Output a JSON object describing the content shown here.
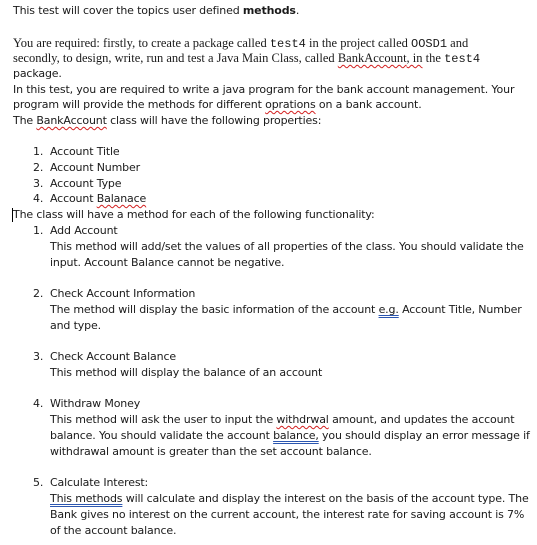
{
  "intro": {
    "text": "This test will cover the topics user defined ",
    "bold": "methods",
    "end": "."
  },
  "requirement": {
    "p1_a": "You are required: firstly, to create a package called ",
    "package_name": "test4",
    "p1_b": " in the project called ",
    "project_name": "OOSD1",
    "p1_c": " and",
    "p2_a": "secondly, to design, write, run and test a Java Main Class, called ",
    "class_name": "BankAccount",
    "p2_b": ", in",
    "p2_c": " the ",
    "package_name_2": "test4",
    "p3": "package."
  },
  "description": {
    "l1": "In this test, you are required to write a java program for the bank account management. Your",
    "l2_a": "program will provide the methods for different ",
    "l2_misspelled": "oprations",
    "l2_b": " on a bank account.",
    "l3_a": "The ",
    "l3_class": "BankAccount",
    "l3_b": " class will have the following properties:"
  },
  "properties": [
    {
      "num": "1.",
      "label": "Account Title"
    },
    {
      "num": "2.",
      "label": "Account Number"
    },
    {
      "num": "3.",
      "label": "Account Type"
    },
    {
      "num": "4.",
      "label_a": "Account ",
      "label_misspelled": "Balanace"
    }
  ],
  "functionality_intro": "The class will have a method for each of the following functionality:",
  "methods": [
    {
      "num": "1.",
      "title": "Add Account",
      "lines": [
        "This method will add/set the values of all properties of the class. You should validate the",
        "input. Account Balance cannot be negative."
      ]
    },
    {
      "num": "2.",
      "title": "Check Account Information",
      "l1_a": "The method will display the basic information of the account ",
      "l1_eg": "e.g.",
      "l1_b": " Account Title, Number",
      "l2": "and type."
    },
    {
      "num": "3.",
      "title": "Check Account Balance",
      "lines": [
        "This method will display the balance of an account"
      ]
    },
    {
      "num": "4.",
      "title": "Withdraw Money",
      "l1_a": "This method will ask the user to input the ",
      "l1_misspelled": "withdrwal",
      "l1_b": " amount, and updates the account",
      "l2_a": "balance. You should validate the account ",
      "l2_gram": "balance,",
      "l2_b": " you should display an error message if",
      "l3": "withdrawal amount is greater than the set account balance."
    },
    {
      "num": "5.",
      "title": "Calculate Interest:",
      "l1_gram": "This methods",
      "l1_b": " will calculate and display the interest on the basis of the account type. The",
      "l2": "Bank gives no interest on the current account, the interest rate for saving account is 7%",
      "l3": "of the account balance."
    }
  ]
}
